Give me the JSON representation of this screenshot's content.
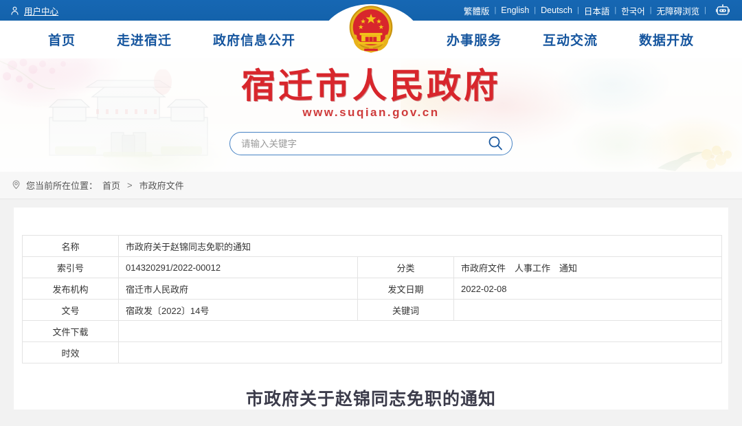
{
  "topbar": {
    "user_center": "用户中心",
    "user_icon": "user-icon",
    "languages": [
      {
        "label": "繁體版"
      },
      {
        "label": "English"
      },
      {
        "label": "Deutsch"
      },
      {
        "label": "日本語"
      },
      {
        "label": "한국어"
      },
      {
        "label": "无障碍浏览"
      }
    ],
    "separator": "|",
    "robot_icon": "robot-icon"
  },
  "nav": {
    "left": [
      {
        "label": "首页"
      },
      {
        "label": "走进宿迁"
      },
      {
        "label": "政府信息公开"
      }
    ],
    "right": [
      {
        "label": "办事服务"
      },
      {
        "label": "互动交流"
      },
      {
        "label": "数据开放"
      }
    ],
    "emblem_icon": "national-emblem-icon"
  },
  "banner": {
    "site_title_cn": "宿迁市人民政府",
    "site_url": "www.suqian.gov.cn",
    "search": {
      "placeholder": "请输入关键字",
      "value": "",
      "icon": "search-icon"
    }
  },
  "breadcrumb": {
    "pin_icon": "location-pin-icon",
    "prefix": "您当前所在位置：",
    "items": [
      {
        "label": "首页"
      },
      {
        "label": "市政府文件"
      }
    ],
    "separator": ">"
  },
  "meta_table": {
    "row1": {
      "label": "名称",
      "value": "市政府关于赵锦同志免职的通知"
    },
    "row2": {
      "label_left": "索引号",
      "value_left": "014320291/2022-00012",
      "label_right": "分类",
      "value_right": "市政府文件　人事工作　通知"
    },
    "row3": {
      "label_left": "发布机构",
      "value_left": "宿迁市人民政府",
      "label_right": "发文日期",
      "value_right": "2022-02-08"
    },
    "row4": {
      "label_left": "文号",
      "value_left": "宿政发〔2022〕14号",
      "label_right": "关键词",
      "value_right": ""
    },
    "row5": {
      "label": "文件下载",
      "value": ""
    },
    "row6": {
      "label": "时效",
      "value": ""
    }
  },
  "document": {
    "title": "市政府关于赵锦同志免职的通知"
  },
  "colors": {
    "topbar_blue": "#1462ab",
    "nav_text_blue": "#15559e",
    "title_red": "#d8262c",
    "page_bg": "#f2f2f2",
    "border_gray": "#e3e3e3"
  }
}
